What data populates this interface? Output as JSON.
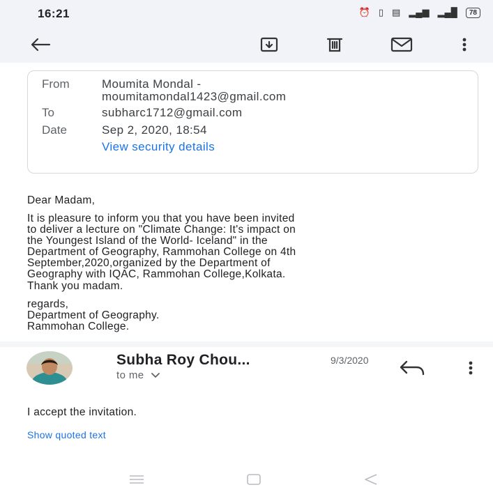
{
  "status_bar": {
    "time": "16:21",
    "icons": [
      "alarm-icon",
      "vibrate-icon",
      "sim-icon",
      "signal-icon",
      "wifi-icon"
    ],
    "battery": "78"
  },
  "app_bar": {
    "icons": [
      "back-arrow-icon",
      "archive-icon",
      "trash-icon",
      "mail-icon",
      "more-vert-icon"
    ]
  },
  "email_header": {
    "from_label": "From",
    "from_name": "Moumita Mondal -",
    "from_email": "moumitamondal1423@gmail.com",
    "to_label": "To",
    "to_email": "subharc1712@gmail.com",
    "date_label": "Date",
    "date_value": "Sep 2, 2020, 18:54",
    "security_link": "View security details"
  },
  "email_body": {
    "greeting": "Dear Madam,",
    "paragraph_lines": [
      "It is pleasure to inform you that you have been invited",
      "to deliver a lecture on \"Climate Change: It's impact on",
      "the Youngest Island of the World- Iceland\" in the",
      "Department of Geography, Rammohan College on 4th",
      "September,2020,organized by the Department of",
      "Geography with IQAC, Rammohan College,Kolkata."
    ],
    "thanks": "Thank you madam.",
    "signoff_lines": [
      "regards,",
      "Department of Geography.",
      "Rammohan College."
    ]
  },
  "reply_message": {
    "sender": "Subha Roy Chou...",
    "date": "9/3/2020",
    "recipient": "to me",
    "text": "I accept the invitation.",
    "show_quoted": "Show quoted text"
  },
  "colors": {
    "app_bar_bg": "#f1f3f9",
    "link": "#1a73e8",
    "text": "#202124"
  }
}
